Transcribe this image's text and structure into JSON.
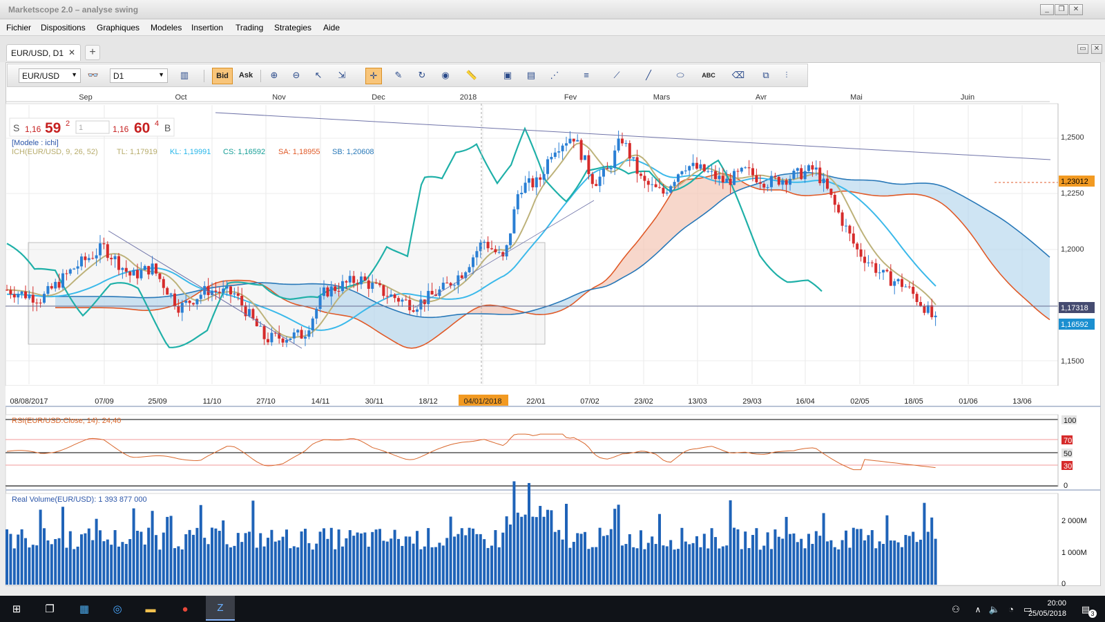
{
  "window": {
    "title": "Marketscope 2.0 – analyse swing"
  },
  "menu": [
    "Fichier",
    "Dispositions",
    "Graphiques",
    "Modeles",
    "Insertion",
    "Trading",
    "Strategies",
    "Aide"
  ],
  "tab": {
    "label": "EUR/USD, D1",
    "close": "✕",
    "add": "+"
  },
  "toolbar": {
    "instrument": "EUR/USD",
    "timeframe": "D1",
    "bid_label": "Bid",
    "ask_label": "Ask",
    "abc_label": "ABC"
  },
  "quote": {
    "sell_letter": "S",
    "sell_prefix": "1,16",
    "sell_big": "59",
    "sell_sup": "2",
    "lot": "1",
    "buy_prefix": "1,16",
    "buy_big": "60",
    "buy_sup": "4",
    "buy_letter": "B"
  },
  "indicator_legend": {
    "model": "[Modele : ichi]",
    "ichimoku": "ICH(EUR/USD, 9, 26, 52)",
    "tl": "TL: 1,17919",
    "kl": "KL: 1,19991",
    "cs": "CS: 1,16592",
    "sa": "SA: 1,18955",
    "sb": "SB: 1,20608"
  },
  "months": [
    "Sep",
    "Oct",
    "Nov",
    "Dec",
    "2018",
    "Fev",
    "Mars",
    "Avr",
    "Mai",
    "Juin"
  ],
  "date_axis": [
    "08/08/2017",
    "07/09",
    "25/09",
    "11/10",
    "27/10",
    "14/11",
    "30/11",
    "18/12",
    "04/01/2018",
    "22/01",
    "07/02",
    "23/02",
    "13/03",
    "29/03",
    "16/04",
    "02/05",
    "18/05",
    "01/06",
    "13/06"
  ],
  "price_axis": [
    "1,2500",
    "1,2250",
    "1,2000",
    "1,1500"
  ],
  "price_tags": {
    "sb": "1,23012",
    "last": "1,17318",
    "cs": "1,16592"
  },
  "rsi": {
    "label": "RSI(EUR/USD.Close, 14): 24,40",
    "levels": [
      "100",
      "70",
      "50",
      "30",
      "0"
    ],
    "current": 24.4
  },
  "volume": {
    "label": "Real Volume(EUR/USD): 1 393 877 000",
    "axis": [
      "2 000M",
      "1 000M",
      "0"
    ]
  },
  "colors": {
    "bull": "#2a7fd4",
    "bear": "#d62b2b",
    "tenkan": "#bdb27a",
    "kijun": "#3bb9ea",
    "chikou": "#1fb0a8",
    "spanA": "#e05a28",
    "spanB": "#2878b8",
    "volume": "#1f63b8"
  },
  "taskbar": {
    "time": "20:00",
    "date": "25/05/2018",
    "notifications": "3"
  }
}
